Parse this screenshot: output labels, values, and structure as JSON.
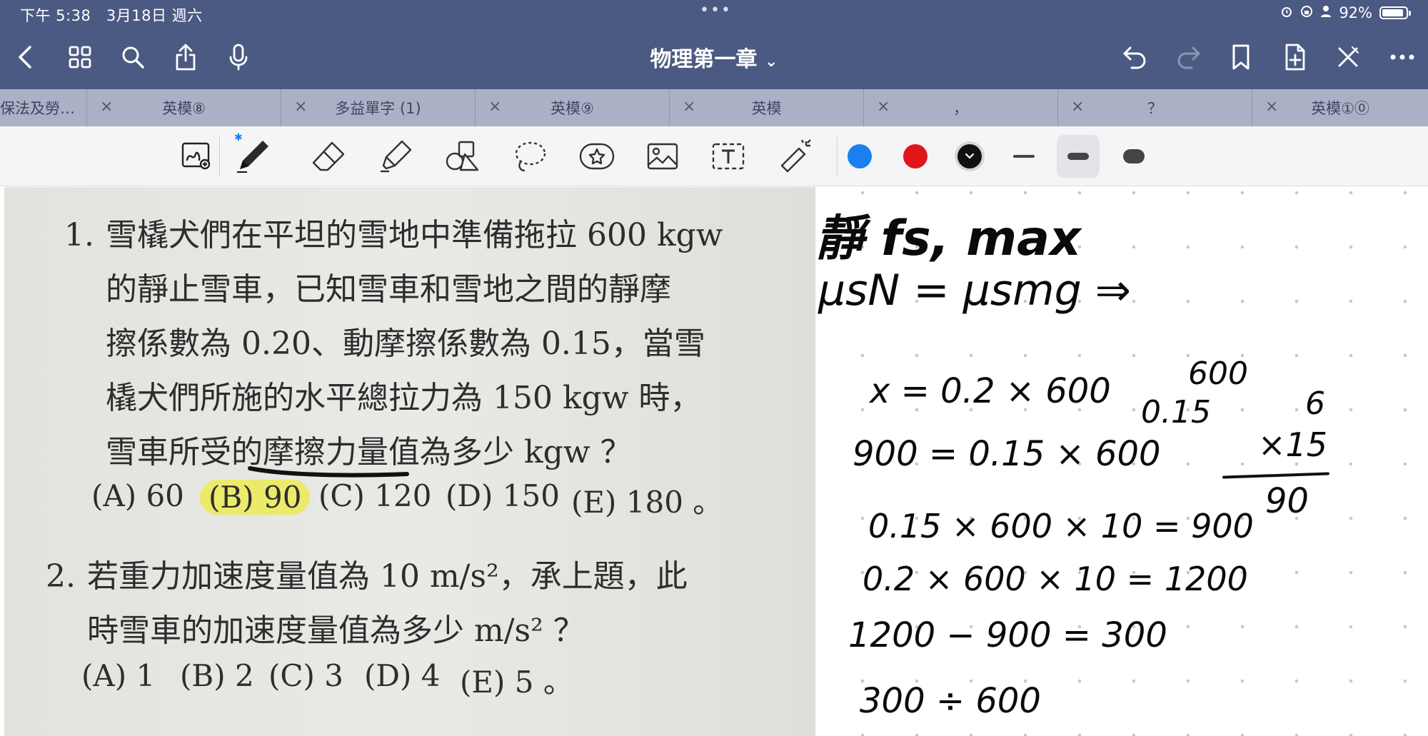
{
  "status": {
    "time": "下午 5:38",
    "date": "3月18日 週六",
    "battery": "92%",
    "battery_level": 0.92
  },
  "header": {
    "title": "物理第一章",
    "chevron": "⌄"
  },
  "icons": {
    "back": "chevron-left-icon",
    "grid": "grid-icon",
    "search": "search-icon",
    "share": "share-icon",
    "mic": "microphone-icon",
    "undo": "undo-icon",
    "redo": "redo-icon",
    "bookmark": "bookmark-icon",
    "add_page": "add-page-icon",
    "close_tool": "pen-off-icon",
    "more": "more-icon"
  },
  "tabs": [
    {
      "label": "保法及勞…"
    },
    {
      "label": "英模⑧"
    },
    {
      "label": "多益單字 (1)"
    },
    {
      "label": "英模⑨"
    },
    {
      "label": "英模"
    },
    {
      "label": "，"
    },
    {
      "label": "？"
    },
    {
      "label": "英模①⓪"
    }
  ],
  "toolbar": {
    "colors": [
      "#1b7ff0",
      "#e0161b",
      "#111111"
    ],
    "bluetooth": "✱"
  },
  "question1": {
    "number": "1.",
    "lines": [
      "雪橇犬們在平坦的雪地中準備拖拉 600 kgw",
      "的靜止雪車，已知雪車和雪地之間的靜摩",
      "擦係數為 0.20、動摩擦係數為 0.15，當雪",
      "橇犬們所施的水平總拉力為 150 kgw 時，",
      "雪車所受的摩擦力量值為多少 kgw ？"
    ],
    "options": [
      "(A) 60",
      "(B) 90",
      "(C) 120",
      "(D) 150",
      "(E) 180 。"
    ]
  },
  "question2": {
    "number": "2.",
    "lines": [
      "若重力加速度量值為 10 m/s²，承上題，此",
      "時雪車的加速度量值為多少 m/s² ？"
    ],
    "options": [
      "(A) 1",
      "(B) 2",
      "(C) 3",
      "(D) 4",
      "(E) 5 。"
    ]
  },
  "notes": {
    "l1": "靜 fs, max",
    "l2": "μsN = μsmg ⇒",
    "l3": "x = 0.2 × 600",
    "l3b": "0.15",
    "l3c": "600",
    "l4": "900 = 0.15 × 600",
    "l5": "0.15 × 600 × 10 = 900",
    "l6": "0.2 × 600 × 10 = 1200",
    "l7": "1200 − 900 = 300",
    "l8": "300 ÷ 600",
    "calc_top": "6",
    "calc_mid": "×15",
    "calc_res": "90"
  }
}
